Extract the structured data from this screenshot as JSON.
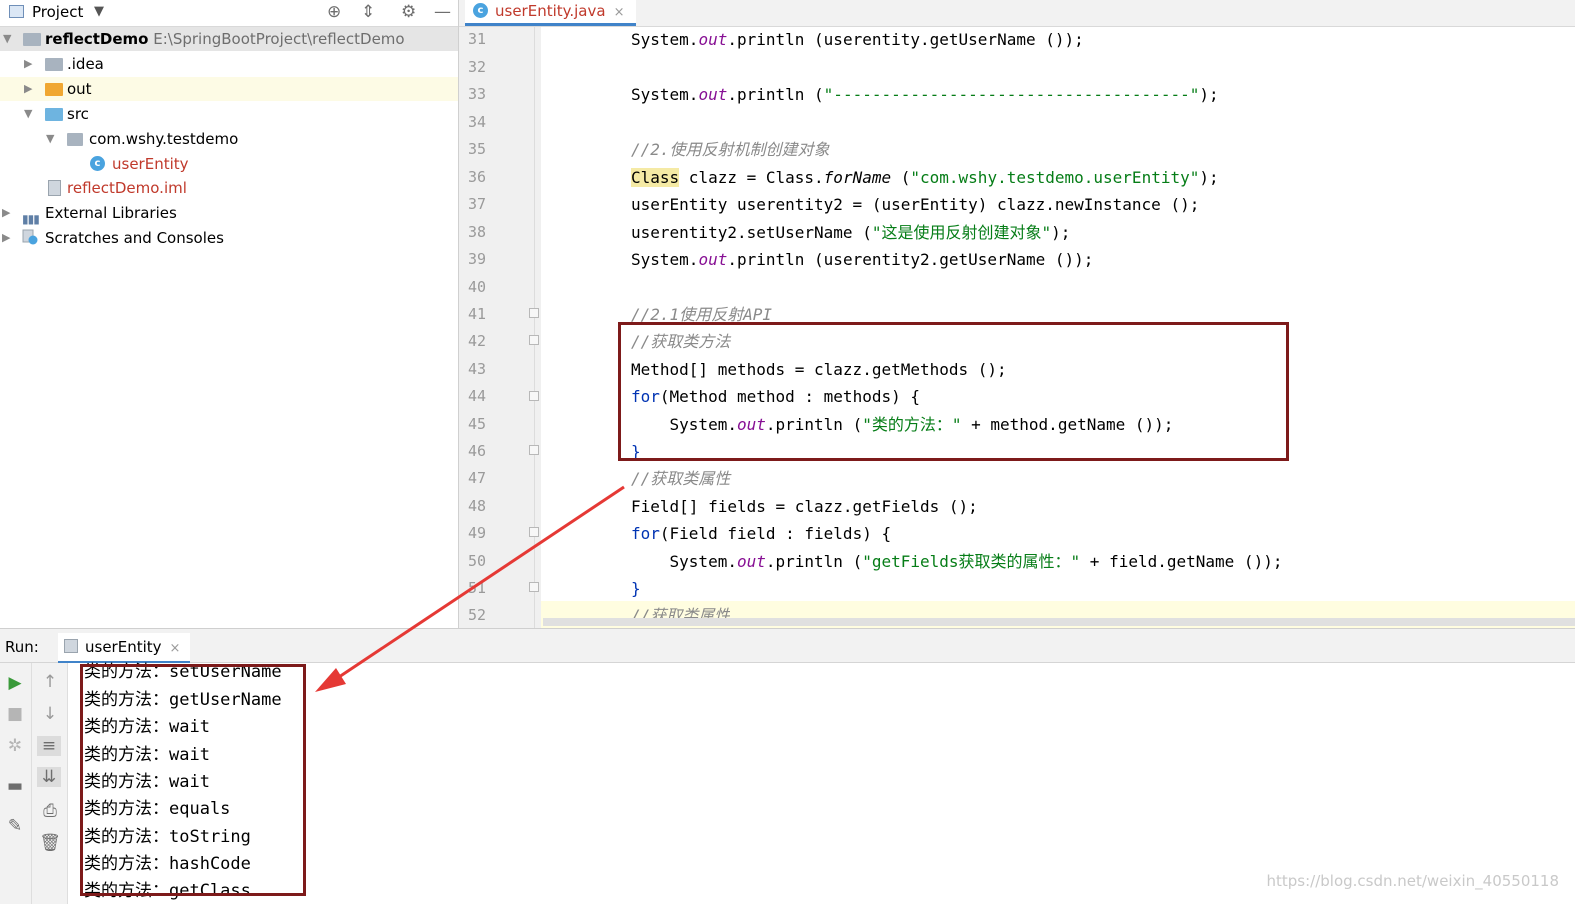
{
  "project_panel": {
    "title": "Project",
    "tree": [
      {
        "label": "reflectDemo",
        "path": "E:\\SpringBootProject\\reflectDemo"
      },
      {
        "label": ".idea"
      },
      {
        "label": "out"
      },
      {
        "label": "src"
      },
      {
        "label": "com.wshy.testdemo"
      },
      {
        "label": "userEntity"
      },
      {
        "label": "reflectDemo.iml"
      },
      {
        "label": "External Libraries"
      },
      {
        "label": "Scratches and Consoles"
      }
    ]
  },
  "editor": {
    "tab": {
      "label": "userEntity.java",
      "close": "×"
    },
    "line_numbers": [
      "31",
      "32",
      "33",
      "34",
      "35",
      "36",
      "37",
      "38",
      "39",
      "40",
      "41",
      "42",
      "43",
      "44",
      "45",
      "46",
      "47",
      "48",
      "49",
      "50",
      "51",
      "52"
    ],
    "code": {
      "l31": {
        "a": "System.",
        "out": "out",
        "b": ".println (userentity.getUserName ());"
      },
      "l33": {
        "a": "System.",
        "out": "out",
        "b": ".println (",
        "str": "\"-------------------------------------\"",
        "c": ");"
      },
      "l35": "//2.使用反射机制创建对象",
      "l36": {
        "cls": "Class",
        "a": " clazz = Class.",
        "fn": "forName",
        "b": " (",
        "str": "\"com.wshy.testdemo.userEntity\"",
        "c": ");"
      },
      "l37": "userEntity userentity2 = (userEntity) clazz.newInstance ();",
      "l38": {
        "a": "userentity2.setUserName (",
        "str": "\"这是使用反射创建对象\"",
        "c": ");"
      },
      "l39": {
        "a": "System.",
        "out": "out",
        "b": ".println (userentity2.getUserName ());"
      },
      "l41": "//2.1使用反射API",
      "l42": "//获取类方法",
      "l43": "Method[] methods = clazz.getMethods ();",
      "l44": {
        "kw": "for",
        "a": "(Method method : methods) {"
      },
      "l45": {
        "a": "    System.",
        "out": "out",
        "b": ".println (",
        "str": "\"类的方法：\"",
        "c": " + method.getName ());"
      },
      "l46": "}",
      "l47": "//获取类属性",
      "l48": "Field[] fields = clazz.getFields ();",
      "l49": {
        "kw": "for",
        "a": "(Field field : fields) {"
      },
      "l50": {
        "a": "    System.",
        "out": "out",
        "b": ".println (",
        "str": "\"getFields获取类的属性：\"",
        "c": " + field.getName ());"
      },
      "l51": "}",
      "l52": "//获取类属性"
    }
  },
  "run_panel": {
    "label": "Run:",
    "tab": {
      "label": "userEntity",
      "close": "×"
    },
    "output": [
      "类的方法：setUserName",
      "类的方法：getUserName",
      "类的方法：wait",
      "类的方法：wait",
      "类的方法：wait",
      "类的方法：equals",
      "类的方法：toString",
      "类的方法：hashCode",
      "类的方法：getClass"
    ]
  },
  "watermark": "https://blog.csdn.net/weixin_40550118",
  "colors": {
    "accent": "#4083c9",
    "annotation": "#7d1a1a",
    "arrow": "#e53935",
    "string": "#067d17",
    "keyword": "#0033b3",
    "comment": "#8a8a8a"
  }
}
